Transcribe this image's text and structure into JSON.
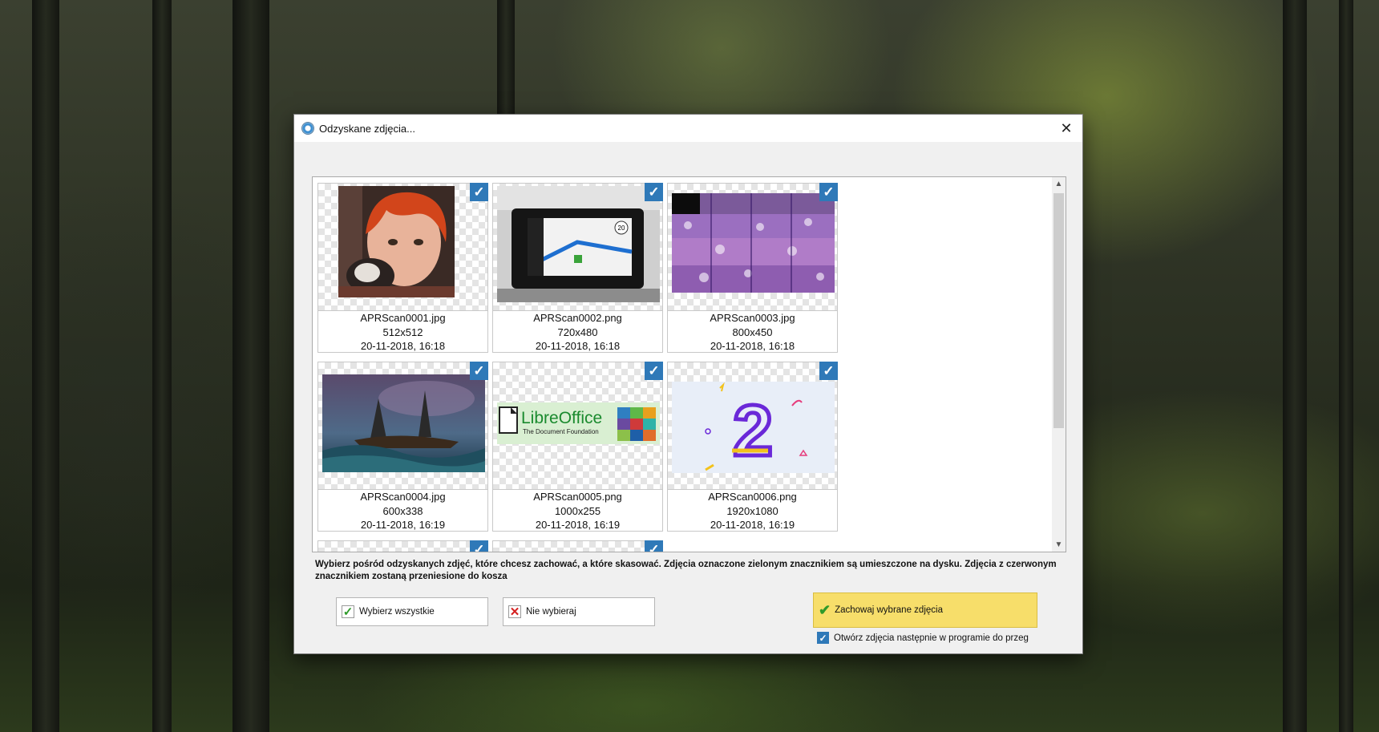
{
  "dialog": {
    "title": "Odzyskane zdjęcia...",
    "close_glyph": "✕"
  },
  "gallery": {
    "items": [
      {
        "filename": "APRScan0001.jpg",
        "dimensions": "512x512",
        "date": "20-11-2018, 16:18",
        "checked": true
      },
      {
        "filename": "APRScan0002.png",
        "dimensions": "720x480",
        "date": "20-11-2018, 16:18",
        "checked": true
      },
      {
        "filename": "APRScan0003.jpg",
        "dimensions": "800x450",
        "date": "20-11-2018, 16:18",
        "checked": true
      },
      {
        "filename": "APRScan0004.jpg",
        "dimensions": "600x338",
        "date": "20-11-2018, 16:19",
        "checked": true
      },
      {
        "filename": "APRScan0005.png",
        "dimensions": "1000x255",
        "date": "20-11-2018, 16:19",
        "checked": true
      },
      {
        "filename": "APRScan0006.png",
        "dimensions": "1920x1080",
        "date": "20-11-2018, 16:19",
        "checked": true
      }
    ],
    "logo": {
      "name": "LibreOffice",
      "tagline": "The Document Foundation"
    },
    "gps_speed": "20",
    "number_graphic": "2"
  },
  "instructions": "Wybierz pośród odzyskanych zdjęć, które chcesz zachować, a które skasować. Zdjęcia oznaczone zielonym znacznikiem są umieszczone na dysku. Zdjęcia z czerwonym znacznikiem zostaną przeniesione do kosza",
  "buttons": {
    "select_all": "Wybierz wszystkie",
    "deselect": "Nie wybieraj",
    "keep_selected": "Zachowaj wybrane zdjęcia"
  },
  "open_next_checkbox": {
    "label": "Otwórz zdjęcia następnie w programie do przeg",
    "checked": true
  },
  "colors": {
    "accent": "#2f79b8",
    "keep_button": "#f7de6a",
    "check_green": "#2f9a2a",
    "cross_red": "#d42020"
  }
}
